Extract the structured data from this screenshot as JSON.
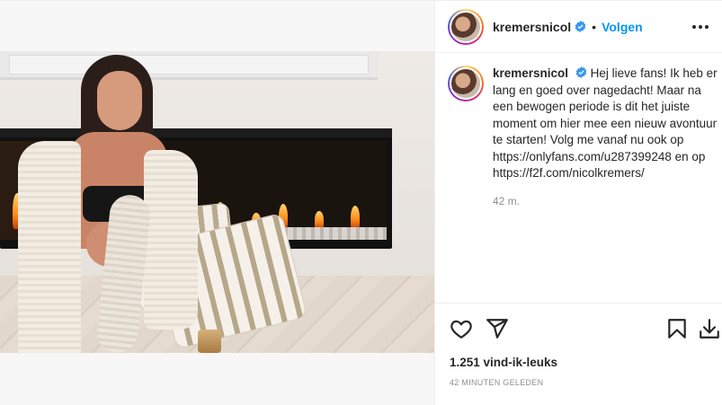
{
  "post": {
    "username": "kremersnicol",
    "verified": true,
    "follow_label": "Volgen",
    "separator": "•",
    "caption": {
      "username": "kremersnicol",
      "text": "Hej lieve fans! Ik heb er lang en goed over nagedacht! Maar na een bewogen periode is dit het juiste moment om hier mee een nieuw avontuur te starten! Volg me vanaf nu ook op ",
      "link1": "https://onlyfans.com/u287399248",
      "between": " en op ",
      "link2": "https://f2f.com/nicolkremers/",
      "time": "42 m."
    },
    "likes": "1.251 vind-ik-leuks",
    "posted": "42 MINUTEN GELEDEN"
  },
  "icons": {
    "like": "heart-icon",
    "share": "send-icon",
    "save": "bookmark-icon",
    "download": "download-icon",
    "more": "more-icon",
    "verified": "verified-badge-icon"
  },
  "colors": {
    "follow": "#0095f6",
    "verified": "#3897f0",
    "muted": "#8e8e8e"
  }
}
